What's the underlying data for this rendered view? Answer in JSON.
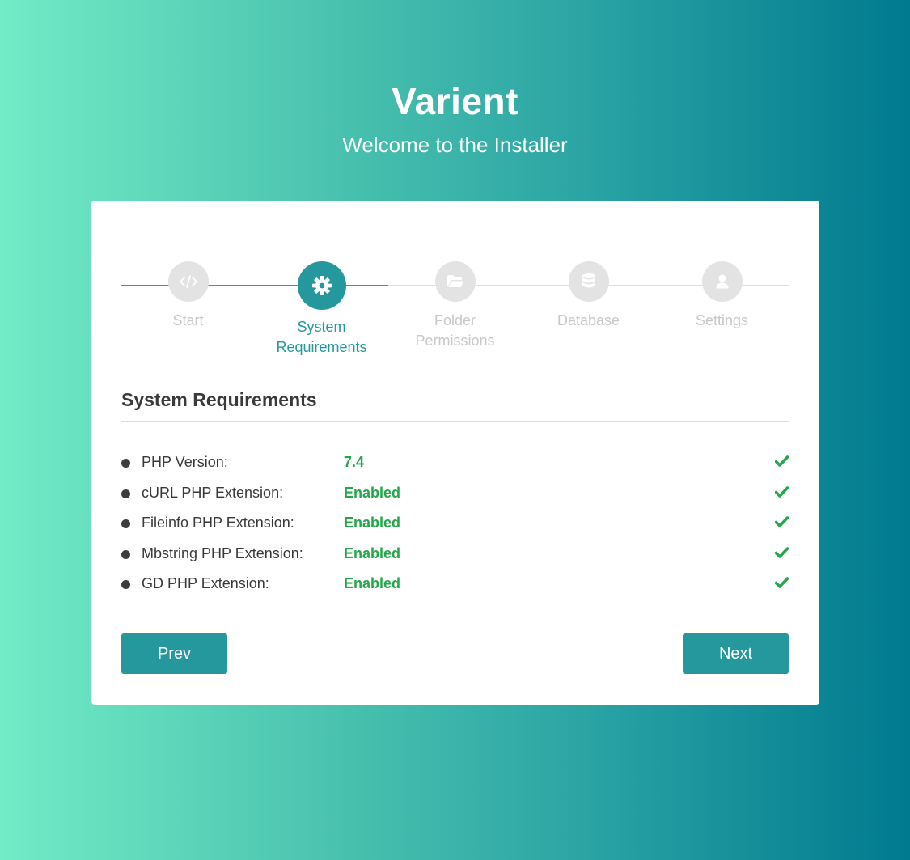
{
  "header": {
    "title": "Varient",
    "subtitle": "Welcome to the Installer"
  },
  "stepper": {
    "steps": [
      {
        "label": "Start",
        "icon": "code-icon",
        "state": "done"
      },
      {
        "label": "System Requirements",
        "icon": "gear-icon",
        "state": "active"
      },
      {
        "label": "Folder Permissions",
        "icon": "folder-open-icon",
        "state": "pending"
      },
      {
        "label": "Database",
        "icon": "database-icon",
        "state": "pending"
      },
      {
        "label": "Settings",
        "icon": "user-icon",
        "state": "pending"
      }
    ]
  },
  "section": {
    "title": "System Requirements"
  },
  "requirements": [
    {
      "label": "PHP Version:",
      "value": "7.4",
      "status": "ok"
    },
    {
      "label": "cURL PHP Extension:",
      "value": "Enabled",
      "status": "ok"
    },
    {
      "label": "Fileinfo PHP Extension:",
      "value": "Enabled",
      "status": "ok"
    },
    {
      "label": "Mbstring PHP Extension:",
      "value": "Enabled",
      "status": "ok"
    },
    {
      "label": "GD PHP Extension:",
      "value": "Enabled",
      "status": "ok"
    }
  ],
  "buttons": {
    "prev_label": "Prev",
    "next_label": "Next"
  },
  "colors": {
    "accent": "#24989c",
    "success": "#27a64c",
    "inactive": "#e3e3e3",
    "gradient_start": "#72ebc6",
    "gradient_end": "#007a8f"
  }
}
